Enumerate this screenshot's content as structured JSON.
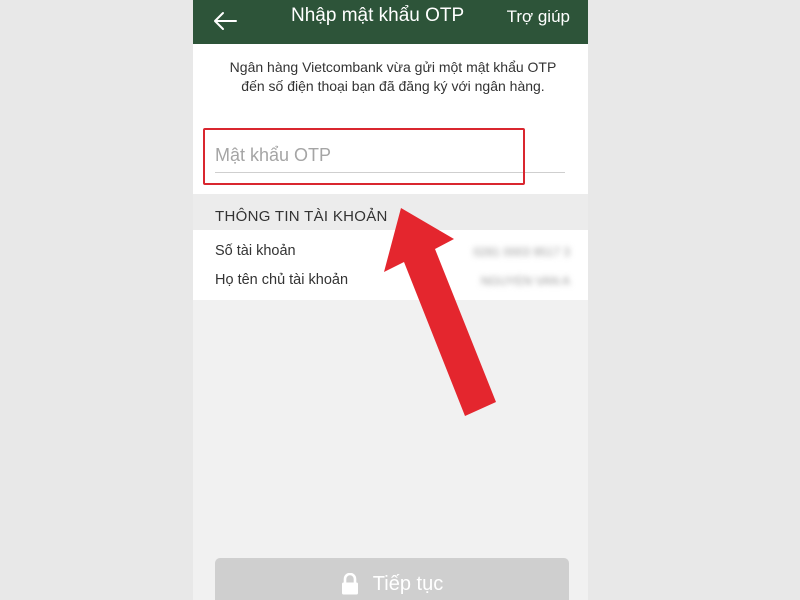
{
  "appbar": {
    "back_icon": "arrow-left-icon",
    "title": "Nhập mật khẩu OTP",
    "help_label": "Trợ giúp",
    "background": "#2d5439"
  },
  "otp": {
    "info_text": "Ngân hàng Vietcombank vừa gửi một mật khẩu OTP đến số điện thoại bạn đã đăng ký với ngân hàng.",
    "placeholder": "Mật khẩu OTP",
    "value": ""
  },
  "account_info": {
    "section_title": "THÔNG TIN TÀI KHOẢN",
    "rows": [
      {
        "label": "Số tài khoản",
        "value": "0281 0003 9517 3"
      },
      {
        "label": "Họ tên chủ tài khoản",
        "value": "NGUYEN VAN A"
      }
    ]
  },
  "continue_button": {
    "label": "Tiếp tục",
    "icon": "lock-icon"
  },
  "annotation": {
    "highlight_color": "#d9262f",
    "arrow_icon": "red-arrow-icon"
  }
}
